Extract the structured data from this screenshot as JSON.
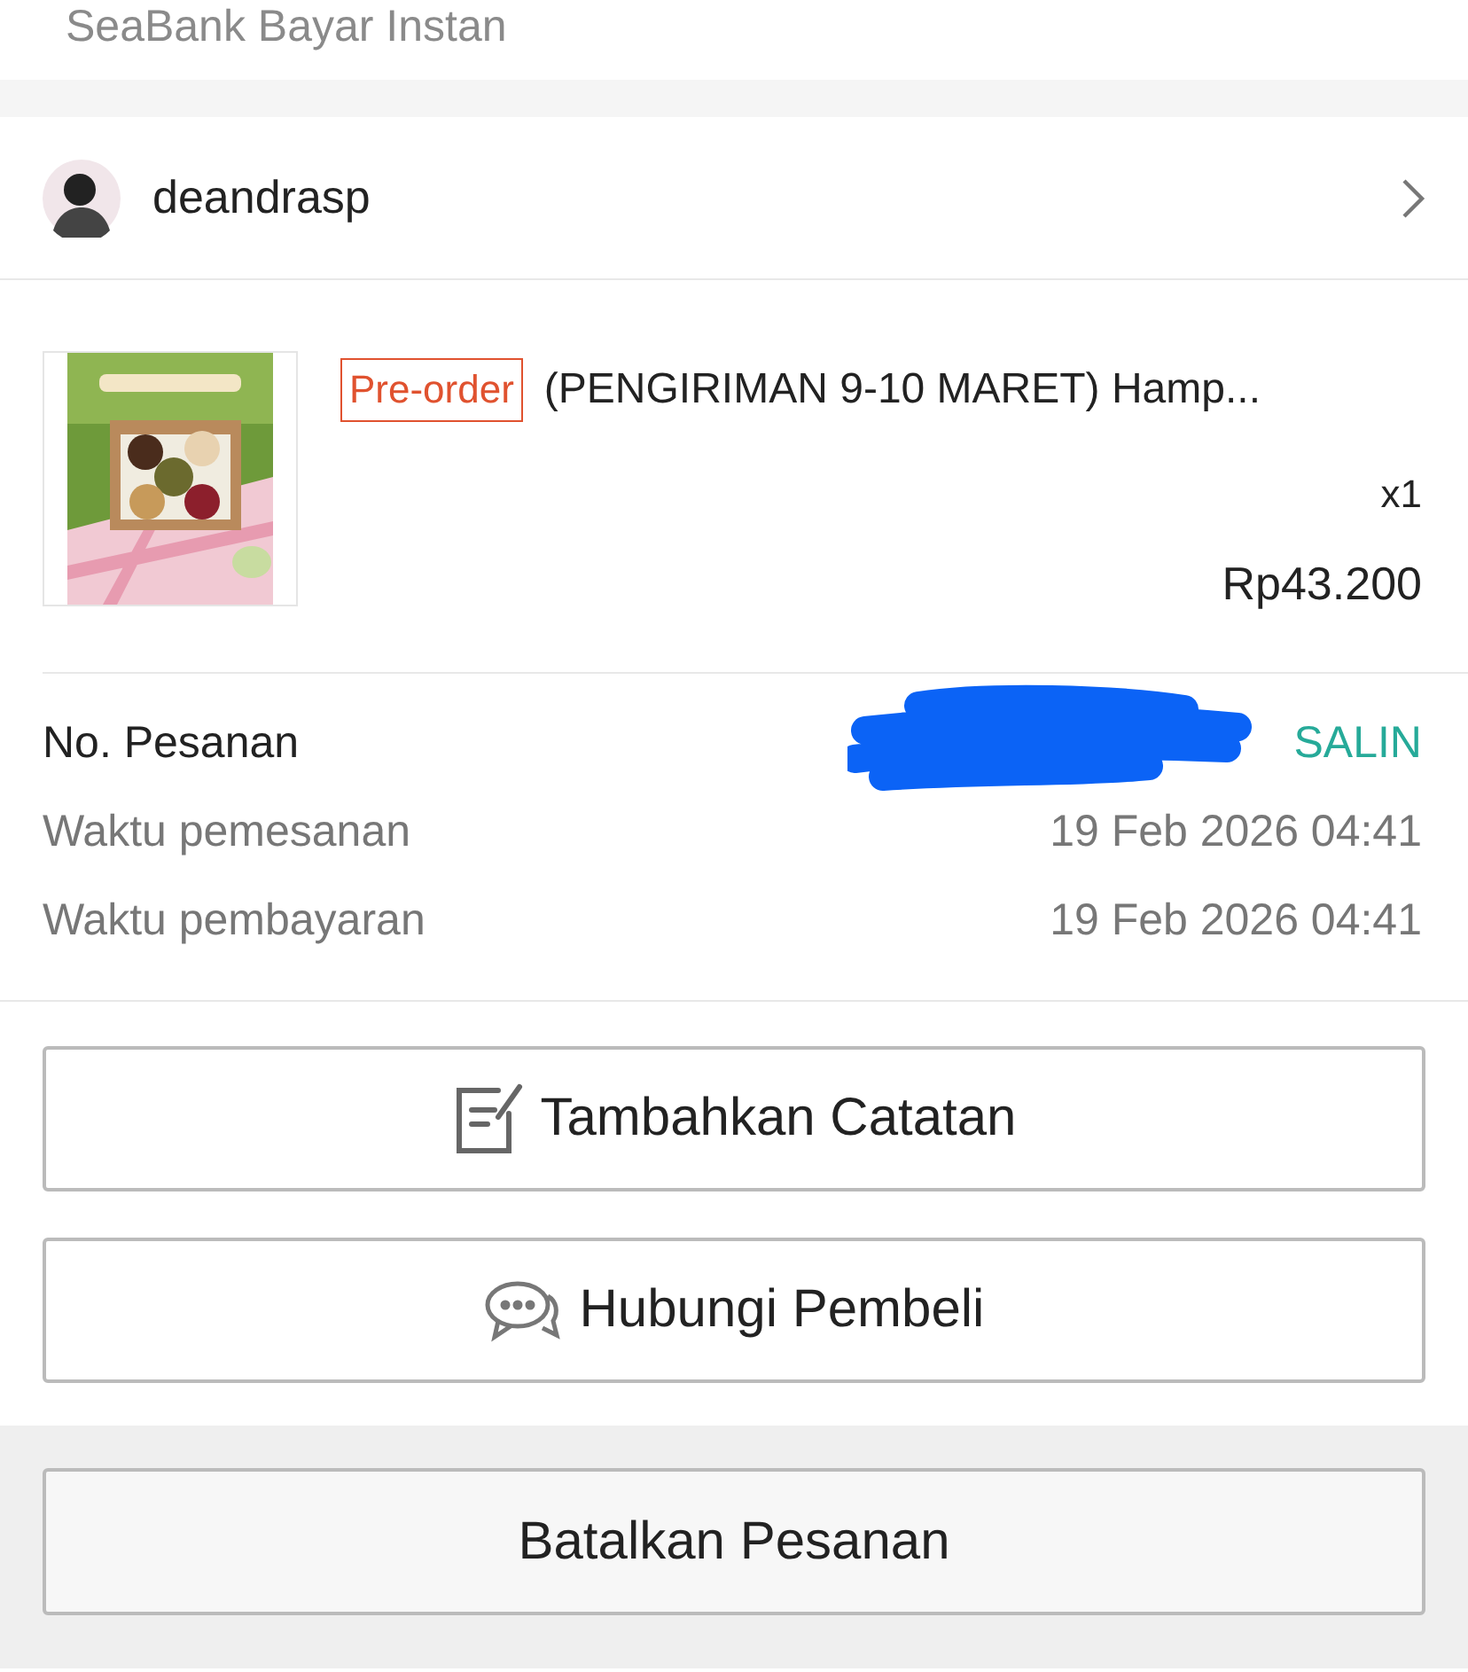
{
  "payment_method": {
    "label": "SeaBank Bayar Instan"
  },
  "seller": {
    "username": "deandrasp"
  },
  "product": {
    "tag": "Pre-order",
    "title": "(PENGIRIMAN 9-10 MARET) Hamp...",
    "quantity": "x1",
    "price": "Rp43.200"
  },
  "order_info": [
    {
      "kind": "copyable",
      "label": "No. Pesanan",
      "value_redacted": true,
      "action": "SALIN"
    },
    {
      "kind": "plain",
      "label": "Waktu pemesanan",
      "value": "19 Feb 2026 04:41"
    },
    {
      "kind": "plain",
      "label": "Waktu pembayaran",
      "value": "19 Feb 2026 04:41"
    }
  ],
  "actions": [
    {
      "kind": "note",
      "label": "Tambahkan Catatan"
    },
    {
      "kind": "chat",
      "label": "Hubungi Pembeli"
    }
  ],
  "footer_button": {
    "label": "Batalkan Pesanan"
  }
}
